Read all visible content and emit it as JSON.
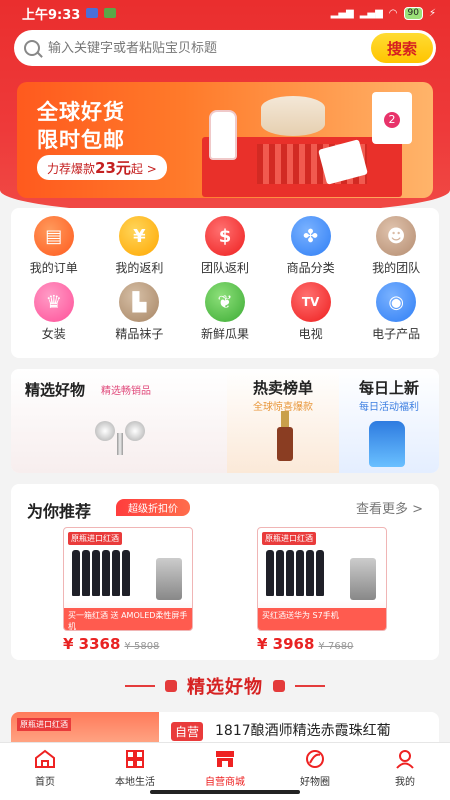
{
  "status": {
    "time": "上午9:33",
    "battery": "90"
  },
  "search": {
    "placeholder": "输入关键字或者粘贴宝贝标题",
    "button": "搜索"
  },
  "banner": {
    "line1": "全球好货",
    "line2": "限时包邮",
    "pill_prefix": "力荐爆款",
    "pill_amount": "23元",
    "pill_suffix": "起 >"
  },
  "categories": [
    {
      "label": "我的订单",
      "icon": "order-icon",
      "color": "#ff6b2d"
    },
    {
      "label": "我的返利",
      "icon": "rebate-icon",
      "color": "#ffb21e"
    },
    {
      "label": "团队返利",
      "icon": "team-rebate-icon",
      "color": "#ff3d3d"
    },
    {
      "label": "商品分类",
      "icon": "category-icon",
      "color": "#3b8cff"
    },
    {
      "label": "我的团队",
      "icon": "team-icon",
      "color": "#c79e80"
    },
    {
      "label": "女装",
      "icon": "women-clothes-icon",
      "color": "#ff66a8"
    },
    {
      "label": "精品袜子",
      "icon": "socks-icon",
      "color": "#b79676"
    },
    {
      "label": "新鲜瓜果",
      "icon": "fruit-icon",
      "color": "#54c04a"
    },
    {
      "label": "电视",
      "icon": "tv-icon",
      "color": "#ff3d3d"
    },
    {
      "label": "电子产品",
      "icon": "gamepad-icon",
      "color": "#3b8cff"
    }
  ],
  "featured": {
    "left": {
      "title": "精选好物",
      "sub": "精选畅销品"
    },
    "mid": {
      "title": "热卖榜单",
      "sub": "全球惊喜爆款"
    },
    "right": {
      "title": "每日上新",
      "sub": "每日活动福利"
    }
  },
  "recommend": {
    "title": "为你推荐",
    "tag": "超级折扣价",
    "more": "查看更多 >",
    "items": [
      {
        "badge": "原瓶进口红酒",
        "foot": "买一箱红酒 送 AMOLED柔性屏手机",
        "price": "¥ 3368",
        "old": "¥ 5808"
      },
      {
        "badge": "原瓶进口红酒",
        "foot": "买红酒送华为 S7手机",
        "price": "¥ 3968",
        "old": "¥ 7680"
      }
    ]
  },
  "section_title": "精选好物",
  "list_item": {
    "thumb_badge": "原瓶进口红酒",
    "self": "自营",
    "name": "1817酿酒师精选赤霞珠红葡"
  },
  "tabs": [
    {
      "label": "首页",
      "icon": "home-icon"
    },
    {
      "label": "本地生活",
      "icon": "local-life-icon"
    },
    {
      "label": "自营商城",
      "icon": "store-icon"
    },
    {
      "label": "好物圈",
      "icon": "circle-icon"
    },
    {
      "label": "我的",
      "icon": "profile-icon"
    }
  ]
}
